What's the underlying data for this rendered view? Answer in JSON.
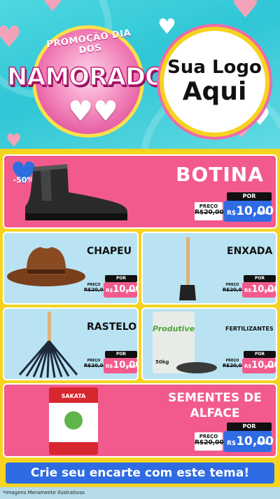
{
  "banner": {
    "promo_top": "PROMOÇÃO DIA DOS",
    "promo_main": "NAMORADOS",
    "logo_line1": "Sua Logo",
    "logo_line2": "Aqui"
  },
  "currency": "R$",
  "unit_label": "UNID",
  "discount_badge": "-50%",
  "products": [
    {
      "name": "BOTINA",
      "preco_label": "PREÇO",
      "old_price": "R$20,00",
      "por_label": "POR",
      "price": "10,00",
      "image": "work-boot-icon"
    },
    {
      "name": "CHAPEU",
      "preco_label": "PREÇO",
      "old_price": "R$20,00",
      "por_label": "POR",
      "price": "10,00",
      "image": "cowboy-hat-icon"
    },
    {
      "name": "ENXADA",
      "preco_label": "PREÇO",
      "old_price": "R$20,00",
      "por_label": "POR",
      "price": "10,00",
      "image": "hoe-icon"
    },
    {
      "name": "RASTELO",
      "preco_label": "PREÇO",
      "old_price": "R$20,00",
      "por_label": "POR",
      "price": "10,00",
      "image": "rake-icon"
    },
    {
      "name": "FERTILIZANTES",
      "preco_label": "PREÇO",
      "old_price": "R$20,00",
      "por_label": "POR",
      "price": "10,00",
      "image": "fertilizer-bag-icon",
      "bag_brand": "Produtive",
      "bag_weight": "50kg"
    },
    {
      "name_line1": "SEMENTES DE",
      "name_line2": "ALFACE",
      "preco_label": "PREÇO",
      "old_price": "R$20,00",
      "por_label": "POR",
      "price": "10,00",
      "image": "seed-pack-icon",
      "pack_brand": "SAKATA"
    }
  ],
  "cta": "Crie seu encarte com este tema!",
  "footnote": "*Imagens Meramente Ilustrativas",
  "colors": {
    "pink": "#f25a8d",
    "blue_card": "#b9e3f3",
    "yellow": "#f5d31f",
    "price_blue": "#2f6be3",
    "header_cyan": "#2fc6d6"
  }
}
